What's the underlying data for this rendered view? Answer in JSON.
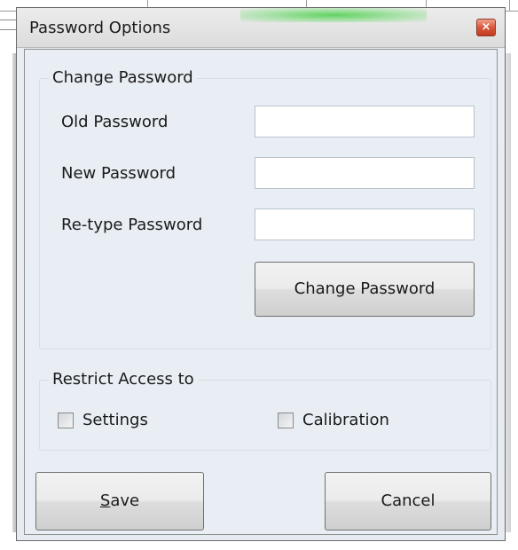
{
  "window": {
    "title": "Password Options",
    "close_glyph": "×",
    "close_icon": "close-icon"
  },
  "change_password": {
    "group_title": "Change Password",
    "old_password_label": "Old Password",
    "new_password_label": "New Password",
    "retype_password_label": "Re-type Password",
    "old_password_value": "",
    "new_password_value": "",
    "retype_password_value": "",
    "button_label": "Change Password"
  },
  "restrict_access": {
    "group_title": "Restrict Access to",
    "options": [
      {
        "label": "Settings",
        "checked": false
      },
      {
        "label": "Calibration",
        "checked": false
      }
    ]
  },
  "buttons": {
    "save_mnemonic": "S",
    "save_rest": "ave",
    "cancel_label": "Cancel"
  },
  "colors": {
    "title_glow": "#5ad25a",
    "close_button": "#d7573c",
    "client_background": "#e9eef4"
  }
}
